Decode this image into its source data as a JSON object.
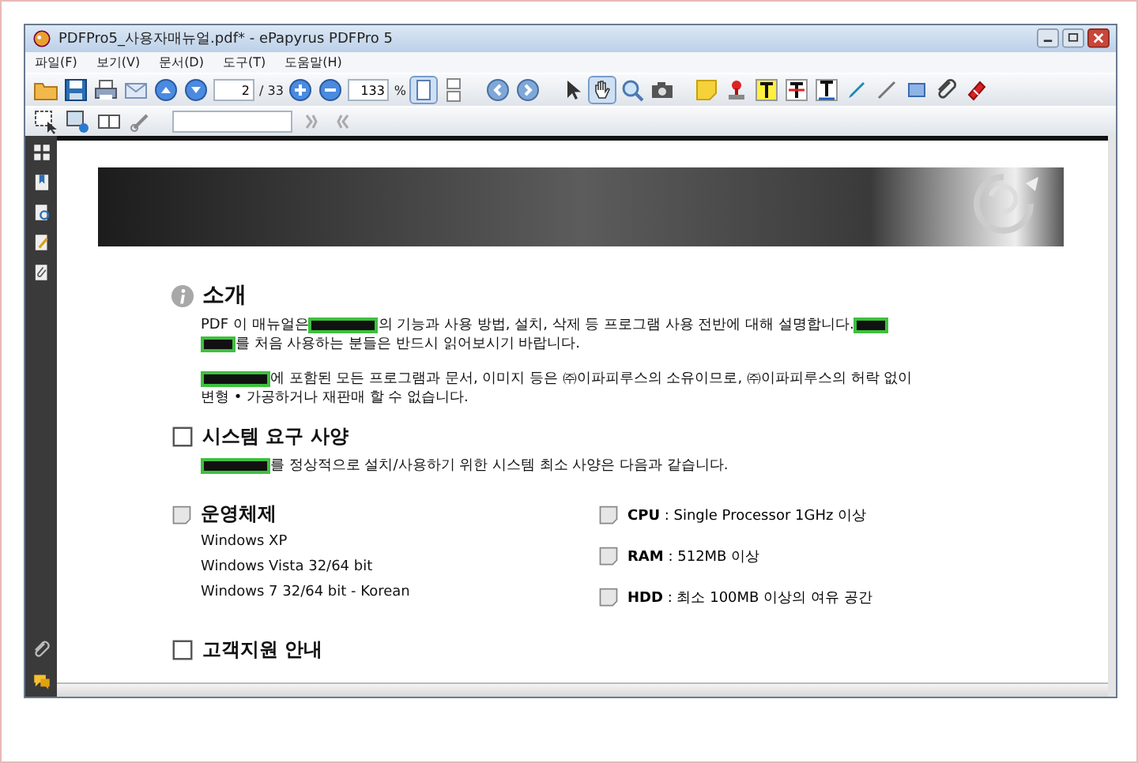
{
  "window": {
    "title": "PDFPro5_사용자매뉴얼.pdf* - ePapyrus PDFPro 5"
  },
  "menu": [
    "파일(F)",
    "보기(V)",
    "문서(D)",
    "도구(T)",
    "도움말(H)"
  ],
  "toolbar": {
    "page": "2",
    "page_total": "/ 33",
    "zoom": "133",
    "zoom_unit": "%"
  },
  "view_modes": [
    {
      "kind": "single",
      "selected": true
    },
    {
      "kind": "continuous",
      "selected": false
    }
  ],
  "tools": [
    {
      "kind": "arrow",
      "selected": false
    },
    {
      "kind": "hand",
      "selected": true
    },
    {
      "kind": "zoom",
      "selected": false
    },
    {
      "kind": "camera",
      "selected": false
    }
  ],
  "document": {
    "sections": [
      {
        "kind": "info",
        "heading": "소개",
        "paragraphs": [
          [
            [
              {
                "kind": "text",
                "text": "PDF 이 매뉴얼은 "
              },
              {
                "kind": "redacted_long"
              },
              {
                "kind": "text",
                "text": "의 기능과 사용 방법, 설치, 삭제 등 프로그램 사용 전반에 대해 설명합니다."
              },
              {
                "kind": "redacted_short"
              }
            ],
            [
              {
                "kind": "redacted_short"
              },
              {
                "kind": "text",
                "text": "를 처음 사용하는 분들은 반드시 읽어보시기 바랍니다."
              }
            ]
          ],
          [
            [
              {
                "kind": "redacted_long"
              },
              {
                "kind": "text",
                "text": "에 포함된 모든 프로그램과 문서, 이미지 등은 ㈜이파피루스의 소유이므로, ㈜이파피루스의 허락 없이"
              }
            ],
            [
              {
                "kind": "text",
                "text": "변형 • 가공하거나 재판매 할 수 없습니다."
              }
            ]
          ]
        ]
      },
      {
        "kind": "box",
        "heading": "시스템 요구 사양",
        "paragraphs": [
          [
            [
              {
                "kind": "redacted_long"
              },
              {
                "kind": "text",
                "text": "를 정상적으로 설치/사용하기 위한 시스템 최소 사양은 다음과 같습니다."
              }
            ]
          ]
        ],
        "os": {
          "heading": "운영체제",
          "lines": [
            "Windows XP",
            "Windows Vista 32/64 bit",
            "Windows 7 32/64 bit - Korean"
          ]
        },
        "specs": [
          {
            "label": "CPU",
            "text": " : Single Processor 1GHz 이상"
          },
          {
            "label": "RAM",
            "text": " : 512MB 이상"
          },
          {
            "label": "HDD",
            "text": " : 최소 100MB 이상의 여유 공간"
          }
        ]
      },
      {
        "kind": "box",
        "heading": "고객지원 안내"
      }
    ]
  }
}
